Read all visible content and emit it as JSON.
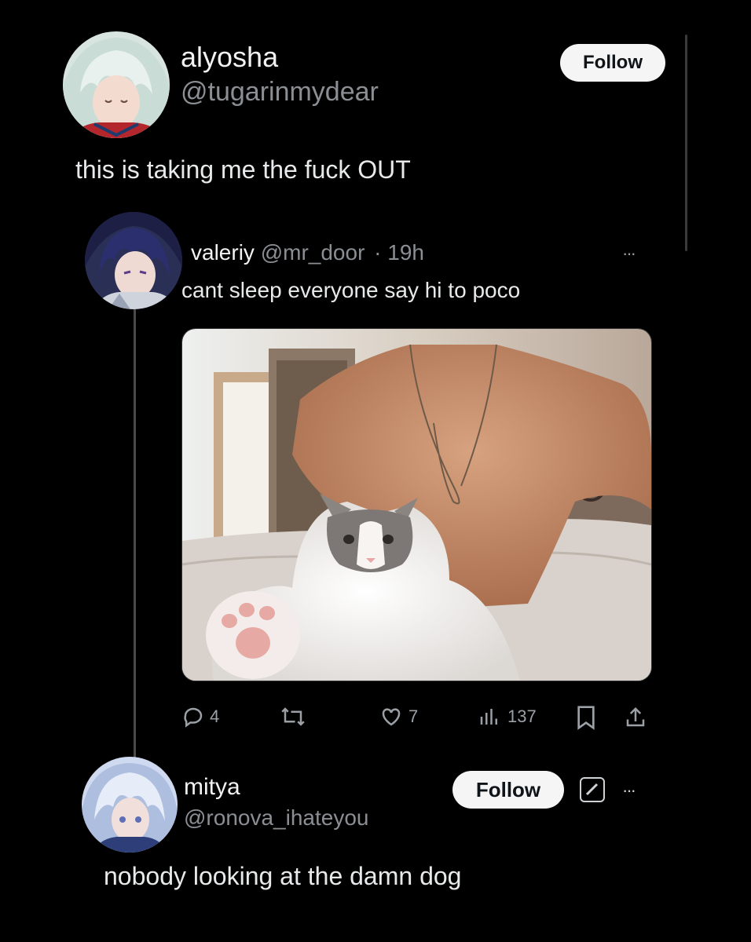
{
  "post": {
    "author_name": "alyosha",
    "author_handle": "@tugarinmydear",
    "follow_label": "Follow",
    "text": "this is taking me the fuck OUT"
  },
  "quoted": {
    "author_name": "valeriy",
    "author_handle": "@mr_door",
    "time": "· 19h",
    "more": "···",
    "text": "cant sleep everyone say hi to poco",
    "actions": {
      "replies": "4",
      "likes": "7",
      "views": "137"
    }
  },
  "reply": {
    "author_name": "mitya",
    "author_handle": "@ronova_ihateyou",
    "follow_label": "Follow",
    "more": "···",
    "text": "nobody looking at the damn dog"
  },
  "icons": [
    "reply-icon",
    "retweet-icon",
    "like-icon",
    "views-icon",
    "bookmark-icon",
    "share-icon",
    "grok-icon",
    "more-icon"
  ],
  "colors": {
    "background": "#000000",
    "text": "#e7e9ea",
    "secondary": "#8b8f94",
    "follow_bg": "#f5f5f5"
  }
}
